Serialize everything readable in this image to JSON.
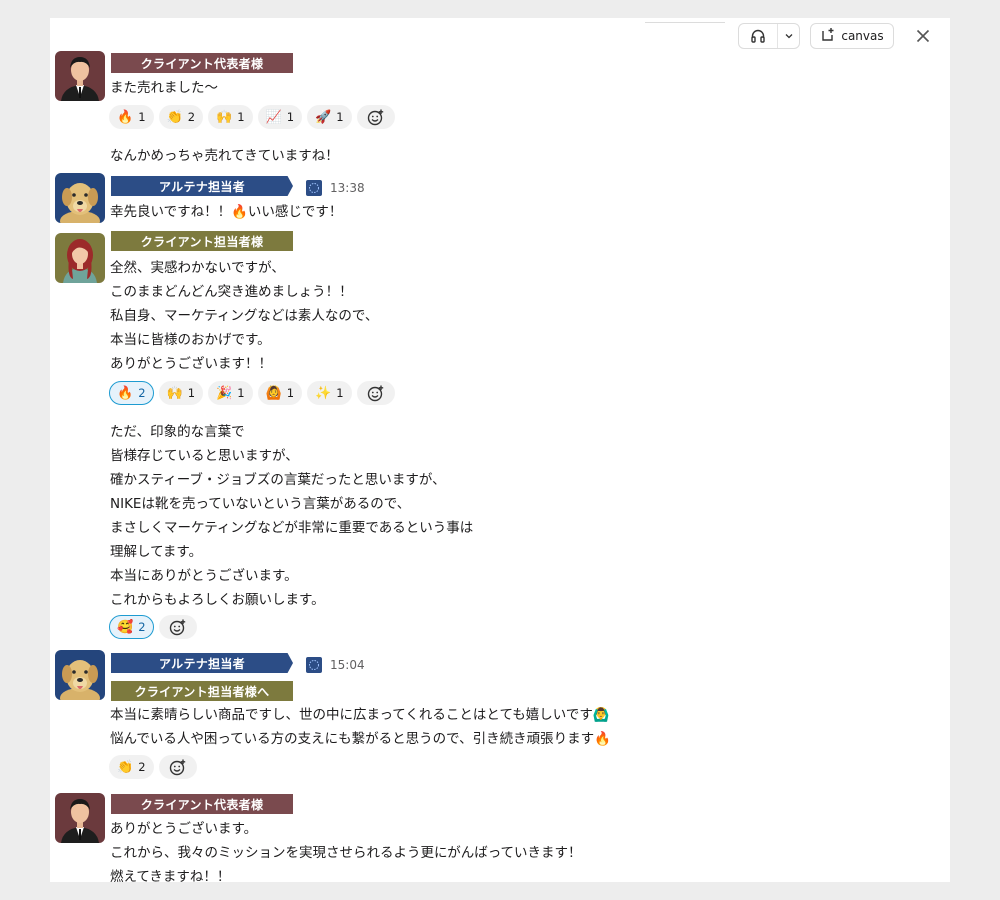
{
  "toolbar": {
    "huddle_icon": "headphones-icon",
    "dropdown_icon": "chevron-down-icon",
    "canvas_label": "canvas",
    "close_icon": "close-icon"
  },
  "labels": {
    "client_rep": "クライアント代表者様",
    "altena": "アルテナ担当者",
    "client_mgr": "クライアント担当者様",
    "to_client": "クライアント担当者様へ"
  },
  "messages": [
    {
      "lines": [
        "また売れました〜"
      ]
    },
    {
      "lines": [
        "なんかめっちゃ売れてきていますね！"
      ]
    },
    {
      "time": "13:38",
      "lines": [
        "幸先良いですね！！🔥いい感じです！"
      ]
    },
    {
      "lines": [
        "全然、実感わかないですが、",
        "このままどんどん突き進めましょう！！",
        "私自身、マーケティングなどは素人なので、",
        "本当に皆様のおかげです。",
        "ありがとうございます！！"
      ]
    },
    {
      "lines": [
        "ただ、印象的な言葉で",
        "皆様存じていると思いますが、",
        "確かスティーブ・ジョブズの言葉だったと思いますが、",
        "NIKEは靴を売っていないという言葉があるので、",
        "まさしくマーケティングなどが非常に重要であるという事は",
        "理解してます。",
        "本当にありがとうございます。",
        "これからもよろしくお願いします。"
      ]
    },
    {
      "time": "15:04",
      "lines": [
        "本当に素晴らしい商品ですし、世の中に広まってくれることはとても嬉しいです🙆‍♂️",
        "悩んでいる人や困っている方の支えにも繋がると思うので、引き続き頑張ります🔥"
      ]
    },
    {
      "lines": [
        "ありがとうございます。",
        "これから、我々のミッションを実現させられるよう更にがんばっていきます！",
        "燃えてきますね！！"
      ]
    }
  ],
  "reactions": {
    "r1": [
      {
        "emoji": "🔥",
        "count": "1"
      },
      {
        "emoji": "👏",
        "count": "2"
      },
      {
        "emoji": "🙌",
        "count": "1"
      },
      {
        "emoji": "📈",
        "count": "1"
      },
      {
        "emoji": "🚀",
        "count": "1"
      }
    ],
    "r2": [
      {
        "emoji": "🔥",
        "count": "2"
      },
      {
        "emoji": "🙌",
        "count": "1"
      },
      {
        "emoji": "🎉",
        "count": "1"
      },
      {
        "emoji": "🙆",
        "count": "1"
      },
      {
        "emoji": "✨",
        "count": "1"
      }
    ],
    "r3": [
      {
        "emoji": "🥰",
        "count": "2"
      }
    ],
    "r4": [
      {
        "emoji": "👏",
        "count": "2"
      }
    ],
    "add_icon": "add-reaction-icon"
  },
  "colors": {
    "client_rep_label": "#7a4a4e",
    "altena_label": "#2c4d86",
    "client_mgr_label": "#7d7a3e",
    "active_reaction": "#1d9bd1"
  }
}
